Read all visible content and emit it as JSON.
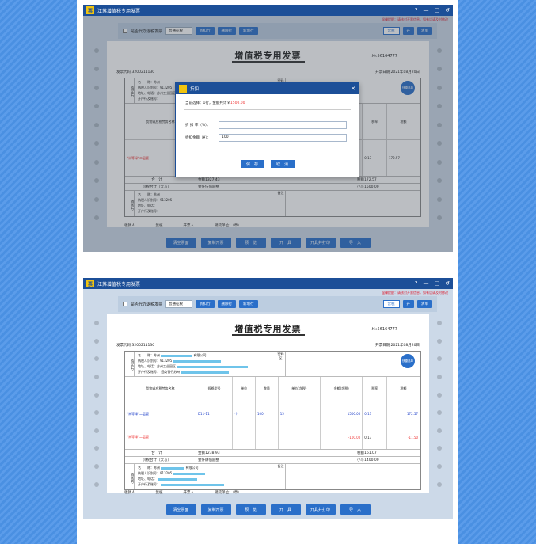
{
  "app": {
    "title": "江苏增值税专用发票",
    "window_controls": [
      "?",
      "—",
      "▢",
      "↺"
    ],
    "notice": "温馨提醒：请核对开票信息，如有误请及时修改"
  },
  "toolbar": {
    "agent_checkbox_label": "是否代办退税发票",
    "invoice_kind": "普通征税",
    "discount_btn": "折扣行",
    "delete_btn": "删除行",
    "add_btn": "新增行",
    "price_label": "含税",
    "price_toggle": "开",
    "list_btn": "清单"
  },
  "invoice": {
    "title": "增值税专用发票",
    "number": "№:56164777",
    "code": "发票代码:3200211130",
    "date": "开票日期:2021年08月20日",
    "buyer_label": "购买方",
    "seller_label": "销售方",
    "mi_label": "密码区",
    "buyer": {
      "name": "名　　称：苏州",
      "name_suffix": "有限公司",
      "tax_id": "纳税人识别号：913205",
      "addr": "地址、电话：苏州工业园区",
      "bank": "开户行及账号：",
      "bank_value": "招商银行苏州"
    },
    "seller": {
      "name": "名　　称：苏州",
      "name_suffix": "有限公司",
      "tax_id": "纳税人识别号：913205",
      "addr": "地址、电话：",
      "bank": "开户行及账号："
    },
    "headers": [
      "货物或应税劳务名称",
      "规格型号",
      "单位",
      "数量",
      "单价(含税)",
      "金额(含税)",
      "税率",
      "税额"
    ],
    "total_label": "合　计",
    "price_total_label": "价税合计（大写）",
    "remark_label": "备注",
    "payee_label": "收款人",
    "reviewer_label": "复核",
    "drawer_label": "开票人",
    "seller_unit_label": "销货单位：（章）",
    "quick_badge": "快捷选单"
  },
  "actions": [
    "清空票面",
    "复制开票",
    "预　览",
    "开　具",
    "开具并打印",
    "导　入"
  ],
  "shot1": {
    "item1": "*米等绿*二层管",
    "item1_rate": "0.13",
    "item1_tax": "172.57",
    "total_amount": "金额1327.43",
    "total_tax": "税额172.57",
    "words": "壹仟伍佰圆整",
    "small": "小写1500.00"
  },
  "shot2": {
    "row1": {
      "name": "*米等绿*二层管",
      "spec": "D11-11",
      "unit": "个",
      "qty": "100",
      "price": "15",
      "amount": "1500.00",
      "rate": "0.13",
      "tax": "172.57"
    },
    "row2": {
      "name": "*米等绿*二层管",
      "amount": "-100.00",
      "rate": "0.13",
      "tax": "-11.50"
    },
    "total_amount": "金额1238.93",
    "total_tax": "税额161.07",
    "words": "壹仟肆佰圆整",
    "small": "小写1400.00"
  },
  "dialog": {
    "title": "折扣",
    "desc_prefix": "当前选择：1行，金额共计￥",
    "desc_amount": "1500.00",
    "rate_label": "折 扣 率（%）：",
    "rate_value": "",
    "amount_label": "折扣金额（¥）：",
    "amount_value": "100",
    "save": "保　存",
    "cancel": "取　消"
  }
}
